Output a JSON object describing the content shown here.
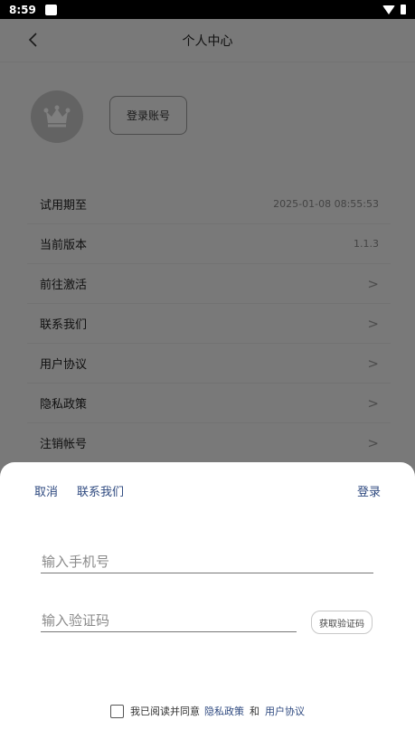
{
  "status_bar": {
    "time": "8:59"
  },
  "header": {
    "title": "个人中心"
  },
  "profile": {
    "login_button": "登录账号"
  },
  "menu": [
    {
      "label": "试用期至",
      "value": "2025-01-08 08:55:53"
    },
    {
      "label": "当前版本",
      "value": "1.1.3"
    },
    {
      "label": "前往激活",
      "value": ">"
    },
    {
      "label": "联系我们",
      "value": ">"
    },
    {
      "label": "用户协议",
      "value": ">"
    },
    {
      "label": "隐私政策",
      "value": ">"
    },
    {
      "label": "注销帐号",
      "value": ">"
    }
  ],
  "login_sheet": {
    "cancel": "取消",
    "contact": "联系我们",
    "login": "登录",
    "phone_placeholder": "输入手机号",
    "code_placeholder": "输入验证码",
    "get_code": "获取验证码",
    "agree_prefix": "我已阅读并同意",
    "privacy_link": "隐私政策",
    "and_text": "和",
    "terms_link": "用户协议",
    "agreed": false
  },
  "colors": {
    "link": "#2f4a80",
    "overlay": "rgba(0,0,0,0.5)"
  }
}
